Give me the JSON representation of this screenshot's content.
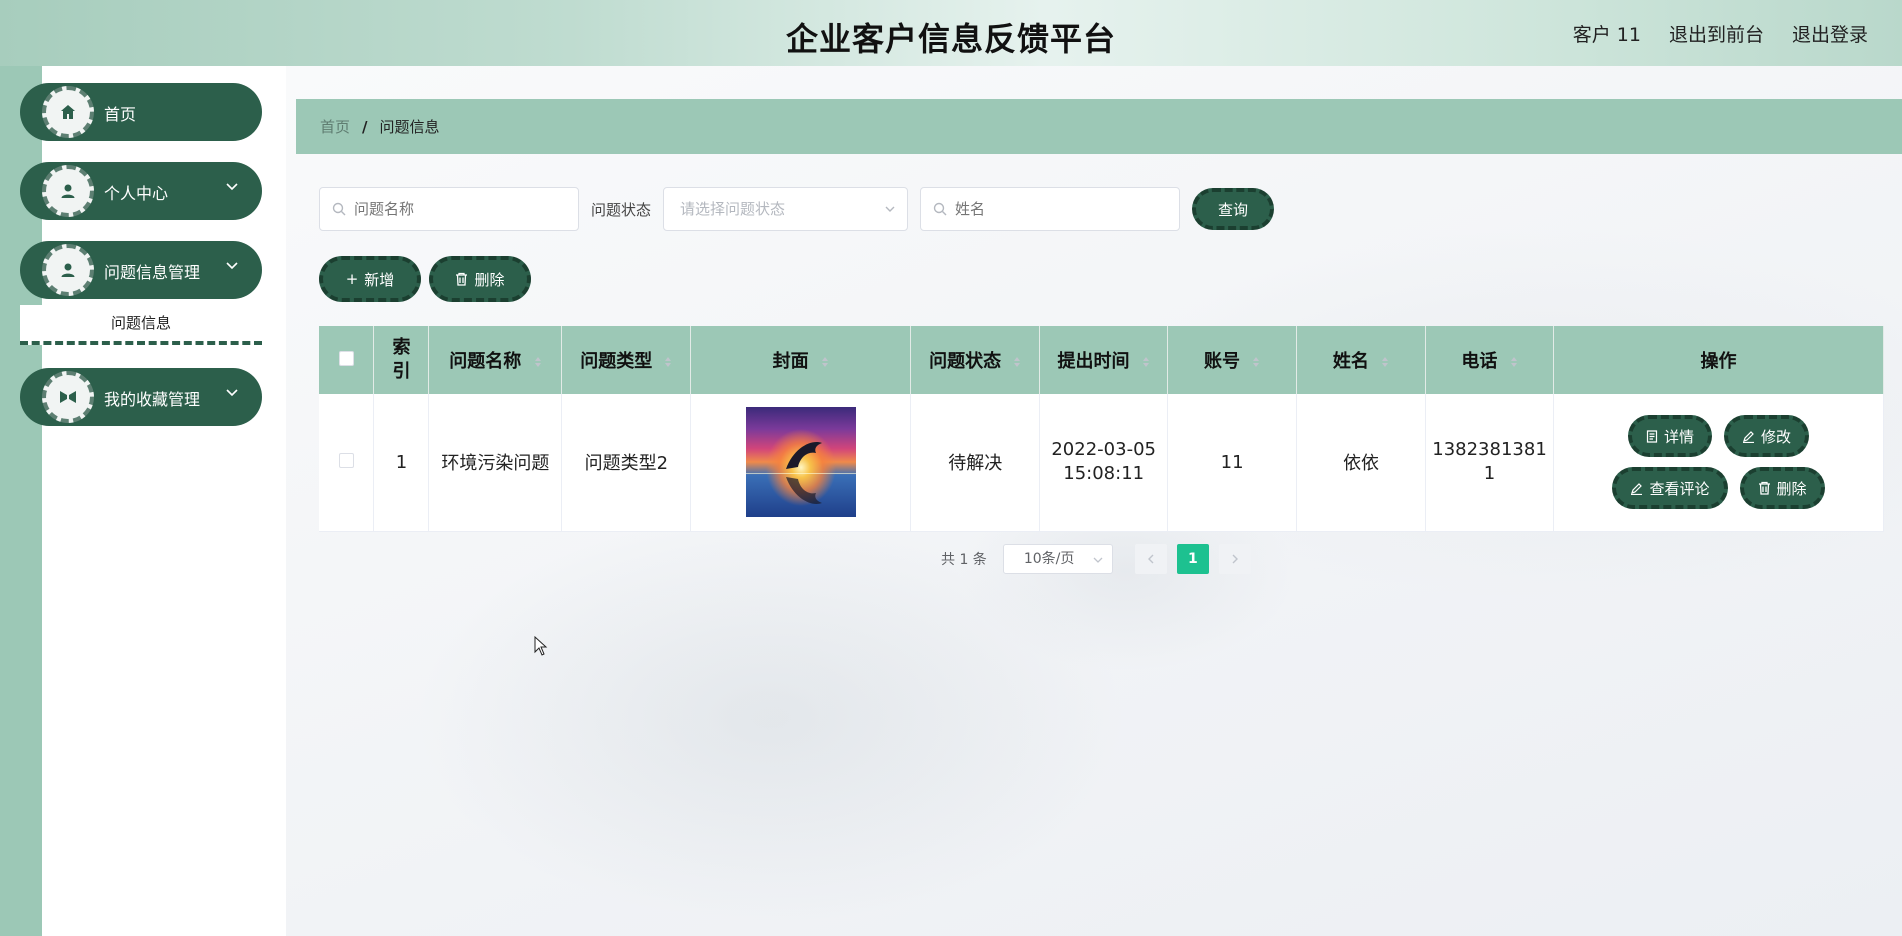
{
  "header": {
    "title": "企业客户信息反馈平台",
    "user_label": "客户 11",
    "to_front_label": "退出到前台",
    "logout_label": "退出登录"
  },
  "sidebar": {
    "items": [
      {
        "label": "首页",
        "icon": "home-icon"
      },
      {
        "label": "个人中心",
        "icon": "user-icon"
      },
      {
        "label": "问题信息管理",
        "icon": "user-icon"
      },
      {
        "label": "我的收藏管理",
        "icon": "collect-icon"
      }
    ],
    "submenu_label": "问题信息"
  },
  "breadcrumb": {
    "home": "首页",
    "separator": "/",
    "current": "问题信息"
  },
  "search": {
    "name_placeholder": "问题名称",
    "status_label": "问题状态",
    "status_placeholder": "请选择问题状态",
    "person_placeholder": "姓名",
    "query_label": "查询"
  },
  "actions": {
    "add_label": "新增",
    "delete_label": "删除"
  },
  "table": {
    "headers": [
      "索引",
      "问题名称",
      "问题类型",
      "封面",
      "问题状态",
      "提出时间",
      "账号",
      "姓名",
      "电话",
      "操作"
    ],
    "rows": [
      {
        "index": "1",
        "name": "环境污染问题",
        "type": "问题类型2",
        "status": "待解决",
        "time_date": "2022-03-05",
        "time_clock": "15:08:11",
        "account": "11",
        "person": "依依",
        "phone_a": "1382381381",
        "phone_b": "1",
        "ops": {
          "detail": "详情",
          "edit": "修改",
          "comments": "查看评论",
          "delete": "删除"
        }
      }
    ]
  },
  "pagination": {
    "total_text": "共 1 条",
    "page_size": "10条/页",
    "current_page": "1"
  },
  "colors": {
    "brand_dark": "#2c5f4b",
    "brand_light": "#9cc8b6",
    "page_active": "#1dc190"
  }
}
